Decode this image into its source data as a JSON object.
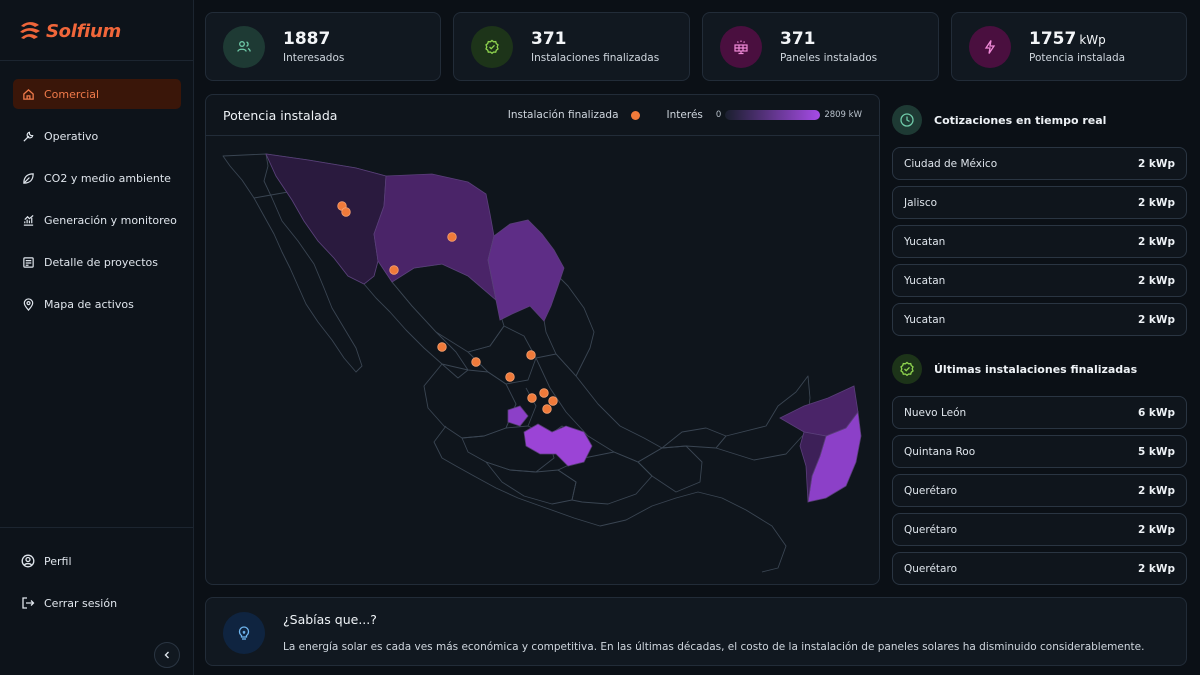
{
  "brand": {
    "name": "Solfium",
    "accent": "#f0663a"
  },
  "sidebar": {
    "items": [
      {
        "label": "Comercial",
        "icon": "home-icon",
        "active": true
      },
      {
        "label": "Operativo",
        "icon": "wrench-icon"
      },
      {
        "label": "CO2 y medio ambiente",
        "icon": "leaf-icon"
      },
      {
        "label": "Generación y monitoreo",
        "icon": "chart-icon"
      },
      {
        "label": "Detalle de proyectos",
        "icon": "document-icon"
      },
      {
        "label": "Mapa de activos",
        "icon": "map-pin-icon"
      }
    ],
    "bottom": [
      {
        "label": "Perfil",
        "icon": "user-icon"
      },
      {
        "label": "Cerrar sesión",
        "icon": "logout-icon"
      }
    ]
  },
  "kpis": [
    {
      "value": "1887",
      "unit": "",
      "label": "Interesados",
      "icon": "users-icon",
      "color": "#1e3a34"
    },
    {
      "value": "371",
      "unit": "",
      "label": "Instalaciones finalizadas",
      "icon": "check-badge-icon",
      "color": "#1d3419"
    },
    {
      "value": "371",
      "unit": "",
      "label": "Paneles instalados",
      "icon": "solar-panel-icon",
      "color": "#4a0f3f"
    },
    {
      "value": "1757",
      "unit": "kWp",
      "label": "Potencia instalada",
      "icon": "bolt-icon",
      "color": "#4a0f3f"
    }
  ],
  "map": {
    "title": "Potencia instalada",
    "legend_installed": "Instalación finalizada",
    "legend_interest": "Interés",
    "scale_min": "0",
    "scale_max": "2809 kW",
    "marker_color": "#f07a3a"
  },
  "realtime": {
    "title": "Cotizaciones en tiempo real",
    "icon": "clock-icon",
    "rows": [
      {
        "name": "Ciudad de México",
        "value": "2 kWp"
      },
      {
        "name": "Jalisco",
        "value": "2 kWp"
      },
      {
        "name": "Yucatan",
        "value": "2 kWp"
      },
      {
        "name": "Yucatan",
        "value": "2 kWp"
      },
      {
        "name": "Yucatan",
        "value": "2 kWp"
      }
    ]
  },
  "latest": {
    "title": "Últimas instalaciones finalizadas",
    "icon": "check-badge-icon",
    "rows": [
      {
        "name": "Nuevo León",
        "value": "6 kWp"
      },
      {
        "name": "Quintana Roo",
        "value": "5 kWp"
      },
      {
        "name": "Querétaro",
        "value": "2 kWp"
      },
      {
        "name": "Querétaro",
        "value": "2 kWp"
      },
      {
        "name": "Querétaro",
        "value": "2 kWp"
      }
    ]
  },
  "tip": {
    "title": "¿Sabías que...?",
    "body": "La energía solar es cada ves más económica y competitiva. En las últimas décadas, el costo de la instalación de paneles solares ha disminuido considerablemente.",
    "icon": "lightbulb-icon"
  }
}
